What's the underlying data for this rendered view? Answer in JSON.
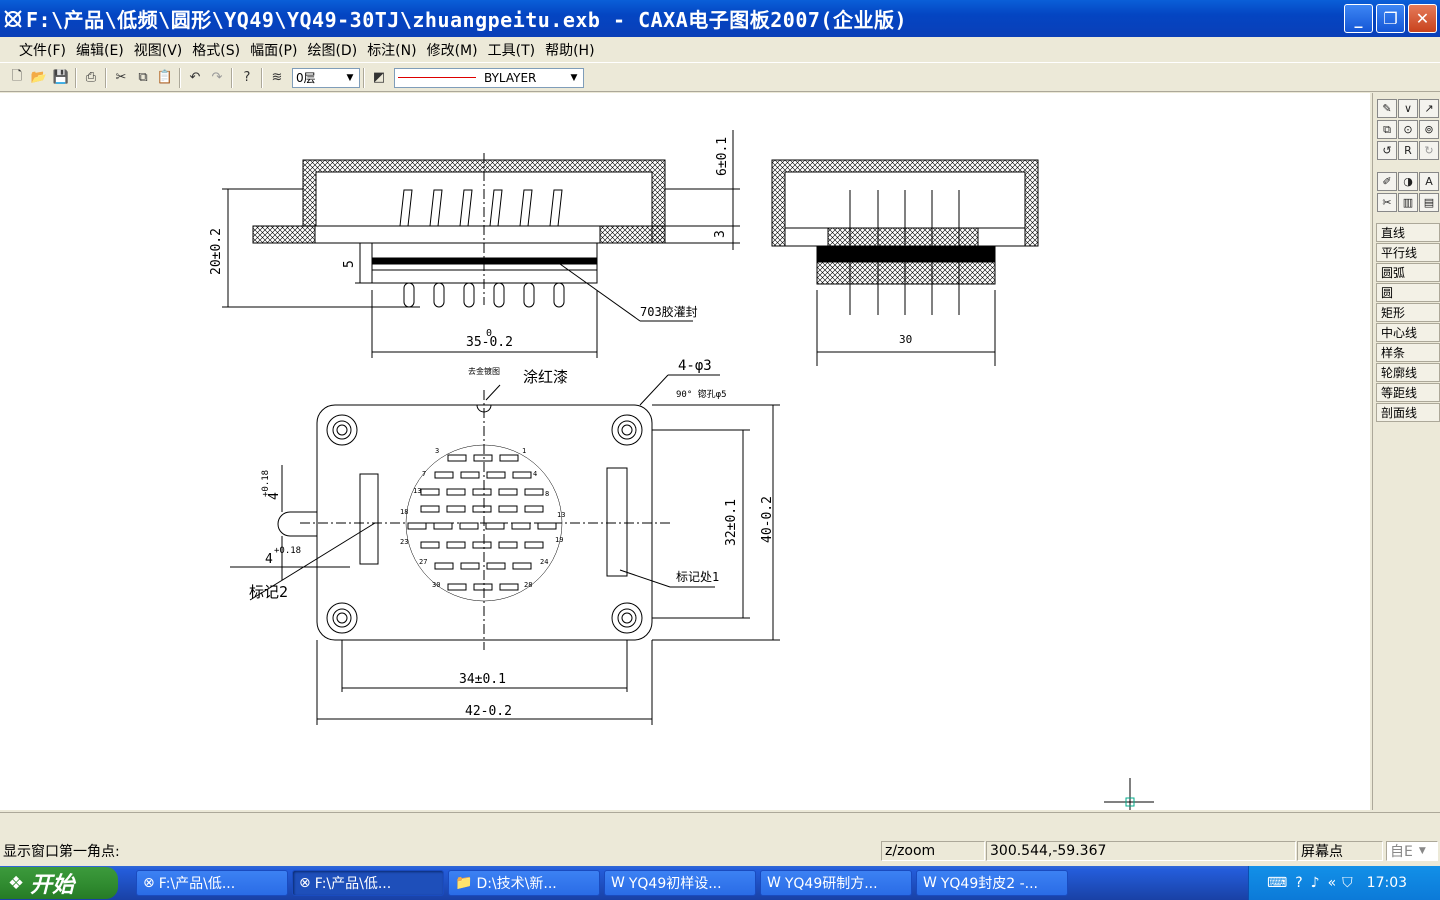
{
  "window": {
    "title": "F:\\产品\\低频\\圆形\\YQ49\\YQ49-30TJ\\zhuangpeitu.exb - CAXA电子图板2007(企业版)",
    "min_icon": "minimize-icon",
    "max_icon": "restore-icon",
    "close_icon": "close-icon"
  },
  "menu": [
    "文件(F)",
    "编辑(E)",
    "视图(V)",
    "格式(S)",
    "幅面(P)",
    "绘图(D)",
    "标注(N)",
    "修改(M)",
    "工具(T)",
    "帮助(H)"
  ],
  "toolbar": {
    "layer": "0层",
    "linetype": "BYLAYER"
  },
  "drawing": {
    "dims": {
      "d20": "20±0.2",
      "d6": "6±0.1",
      "d3": "3",
      "d5": "5",
      "d35": "35-0.2",
      "d35sup": "0",
      "sealant": "703胶灌封",
      "d30": "30",
      "paint": "涂红漆",
      "paintnote": "去金镀图",
      "holes": "4-φ3",
      "csink": "90° 锪孔φ5",
      "d4a": "4",
      "d4a_tol": "+0.18",
      "d4b": "4",
      "d4b_tol": "+0.18",
      "mark2": "标记2",
      "mark1": "标记处1",
      "d32": "32±0.1",
      "d40": "40-0.2",
      "d34": "34±0.1",
      "d42": "42-0.2",
      "pin_numbers": [
        "3",
        "1",
        "7",
        "4",
        "13",
        "8",
        "18",
        "13",
        "23",
        "19",
        "27",
        "24",
        "30",
        "28"
      ]
    }
  },
  "right_panel": {
    "items": [
      "直线",
      "平行线",
      "圆弧",
      "圆",
      "矩形",
      "中心线",
      "样条",
      "轮廓线",
      "等距线",
      "剖面线"
    ]
  },
  "status": {
    "prompt": "显示窗口第一角点:",
    "command": "z/zoom",
    "coords": "300.544,-59.367",
    "snap": "屏幕点",
    "mode": "自E"
  },
  "taskbar": {
    "start": "开始",
    "buttons": [
      "F:\\产品\\低...",
      "F:\\产品\\低...",
      "D:\\技术\\新...",
      "YQ49初样设...",
      "YQ49研制方...",
      "YQ49封皮2 -..."
    ],
    "clock": "17:03"
  }
}
